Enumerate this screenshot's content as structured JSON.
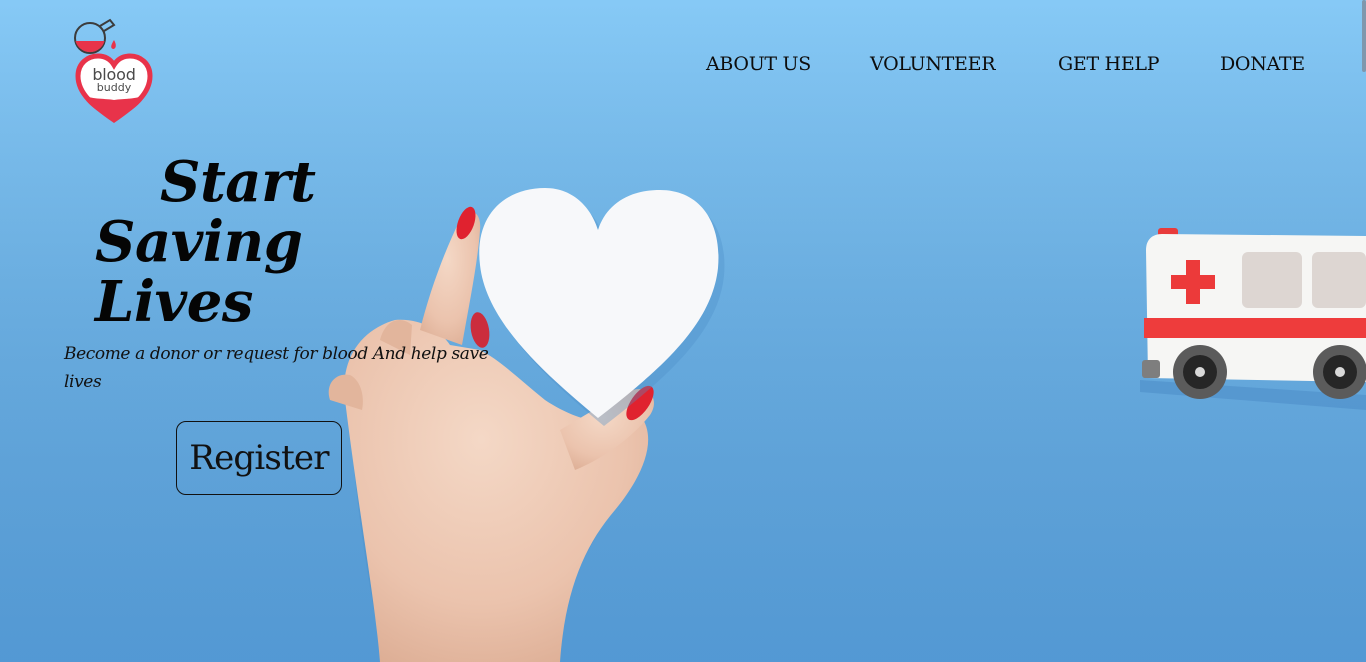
{
  "brand": {
    "logo_line1": "blood",
    "logo_line2": "buddy",
    "accent_color": "#e8334a"
  },
  "nav": {
    "items": [
      {
        "label": "ABOUT US"
      },
      {
        "label": "VOLUNTEER"
      },
      {
        "label": "GET HELP"
      },
      {
        "label": "DONATE"
      }
    ]
  },
  "hero": {
    "headline_line1": "Start",
    "headline_line2": "Saving",
    "headline_line3": "Lives",
    "subtitle": "Become a donor or request for blood And help save lives",
    "register_label": "Register",
    "background_color": "#7cc1f3"
  },
  "icons": [
    "flask-icon",
    "blood-drop-icon",
    "heart-logo-icon",
    "paper-heart-image",
    "hand-image",
    "ambulance-image"
  ]
}
